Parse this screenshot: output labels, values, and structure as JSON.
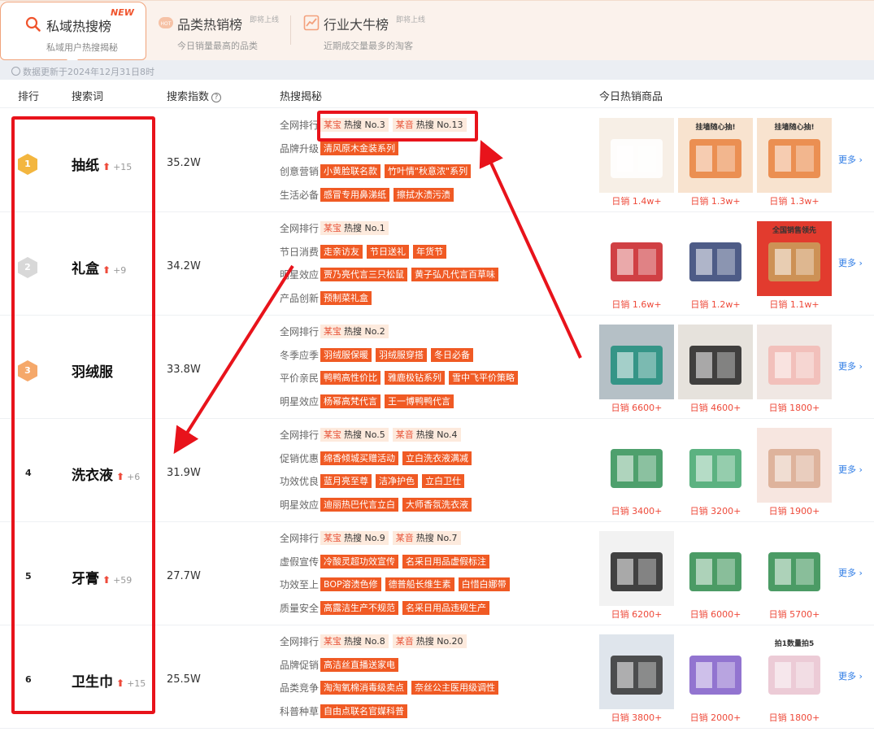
{
  "tabs": [
    {
      "title": "私域热搜榜",
      "subtitle": "私域用户热搜揭秘",
      "badge": "NEW"
    },
    {
      "title": "品类热销榜",
      "subtitle": "今日销量最高的品类",
      "badge": "即将上线"
    },
    {
      "title": "行业大牛榜",
      "subtitle": "近期成交量最多的淘客",
      "badge": "即将上线"
    }
  ],
  "notice": "数据更新于2024年12月31日8时",
  "columns": {
    "rank": "排行",
    "keyword": "搜索词",
    "index": "搜索指数",
    "insight": "热搜揭秘",
    "products": "今日热销商品",
    "help_icon": "?"
  },
  "more_label": "更多 ›",
  "colors": {
    "accent": "#f05a24",
    "link": "#2d7be5",
    "rise": "#ee4a3a",
    "annotation": "#e8131b"
  },
  "rows": [
    {
      "rank": "1",
      "keyword": "抽纸",
      "arrow": "⬆",
      "delta": "+15",
      "index": "35.2W",
      "sections": [
        {
          "label": "全网排行",
          "chips": [
            {
              "type": "rank",
              "platform": "某宝",
              "text": "热搜 No.3"
            },
            {
              "type": "rank",
              "platform": "某音",
              "text": "热搜 No.13"
            }
          ]
        },
        {
          "label": "品牌升级",
          "chips": [
            {
              "type": "orange",
              "text": "清风原木金装系列"
            }
          ]
        },
        {
          "label": "创意营销",
          "chips": [
            {
              "type": "orange",
              "text": "小黄脸联名款"
            },
            {
              "type": "orange",
              "text": "竹叶情\"秋意浓\"系列"
            }
          ]
        },
        {
          "label": "生活必备",
          "chips": [
            {
              "type": "orange",
              "text": "感冒专用鼻涕纸"
            },
            {
              "type": "orange",
              "text": "擦拭水渍污渍"
            }
          ]
        }
      ],
      "products": [
        {
          "sales": "日销 1.4w+"
        },
        {
          "sales": "日销 1.3w+",
          "caption": "挂墙随心抽!"
        },
        {
          "sales": "日销 1.3w+",
          "caption": "挂墙随心抽!"
        }
      ]
    },
    {
      "rank": "2",
      "keyword": "礼盒",
      "arrow": "⬆",
      "delta": "+9",
      "index": "34.2W",
      "sections": [
        {
          "label": "全网排行",
          "chips": [
            {
              "type": "rank",
              "platform": "某宝",
              "text": "热搜 No.1"
            }
          ]
        },
        {
          "label": "节日消费",
          "chips": [
            {
              "type": "orange",
              "text": "走亲访友"
            },
            {
              "type": "orange",
              "text": "节日送礼"
            },
            {
              "type": "orange",
              "text": "年货节"
            }
          ]
        },
        {
          "label": "明星效应",
          "chips": [
            {
              "type": "orange",
              "text": "贾乃亮代言三只松鼠"
            },
            {
              "type": "orange",
              "text": "黄子弘凡代言百草味"
            }
          ]
        },
        {
          "label": "产品创新",
          "chips": [
            {
              "type": "orange",
              "text": "预制菜礼盒"
            }
          ]
        }
      ],
      "products": [
        {
          "sales": "日销 1.6w+"
        },
        {
          "sales": "日销 1.2w+"
        },
        {
          "sales": "日销 1.1w+",
          "caption": "全国销售领先"
        }
      ]
    },
    {
      "rank": "3",
      "keyword": "羽绒服",
      "arrow": "",
      "delta": "",
      "index": "33.8W",
      "sections": [
        {
          "label": "全网排行",
          "chips": [
            {
              "type": "rank",
              "platform": "某宝",
              "text": "热搜 No.2"
            }
          ]
        },
        {
          "label": "冬季应季",
          "chips": [
            {
              "type": "orange",
              "text": "羽绒服保暖"
            },
            {
              "type": "orange",
              "text": "羽绒服穿搭"
            },
            {
              "type": "orange",
              "text": "冬日必备"
            }
          ]
        },
        {
          "label": "平价亲民",
          "chips": [
            {
              "type": "orange",
              "text": "鸭鸭高性价比"
            },
            {
              "type": "orange",
              "text": "雅鹿极钻系列"
            },
            {
              "type": "orange",
              "text": "雪中飞平价策略"
            }
          ]
        },
        {
          "label": "明星效应",
          "chips": [
            {
              "type": "orange",
              "text": "杨幂高梵代言"
            },
            {
              "type": "orange",
              "text": "王一博鸭鸭代言"
            }
          ]
        }
      ],
      "products": [
        {
          "sales": "日销 6600+"
        },
        {
          "sales": "日销 4600+"
        },
        {
          "sales": "日销 1800+"
        }
      ]
    },
    {
      "rank": "4",
      "keyword": "洗衣液",
      "arrow": "⬆",
      "delta": "+6",
      "index": "31.9W",
      "sections": [
        {
          "label": "全网排行",
          "chips": [
            {
              "type": "rank",
              "platform": "某宝",
              "text": "热搜 No.5"
            },
            {
              "type": "rank",
              "platform": "某音",
              "text": "热搜 No.4"
            }
          ]
        },
        {
          "label": "促销优惠",
          "chips": [
            {
              "type": "orange",
              "text": "绵香倾城买赠活动"
            },
            {
              "type": "orange",
              "text": "立白洗衣液满减"
            }
          ]
        },
        {
          "label": "功效优良",
          "chips": [
            {
              "type": "orange",
              "text": "蓝月亮至尊"
            },
            {
              "type": "orange",
              "text": "洁净护色"
            },
            {
              "type": "orange",
              "text": "立白卫仕"
            }
          ]
        },
        {
          "label": "明星效应",
          "chips": [
            {
              "type": "orange",
              "text": "迪丽热巴代言立白"
            },
            {
              "type": "orange",
              "text": "大师香氛洗衣液"
            }
          ]
        }
      ],
      "products": [
        {
          "sales": "日销 3400+"
        },
        {
          "sales": "日销 3200+"
        },
        {
          "sales": "日销 1900+"
        }
      ]
    },
    {
      "rank": "5",
      "keyword": "牙膏",
      "arrow": "⬆",
      "delta": "+59",
      "index": "27.7W",
      "sections": [
        {
          "label": "全网排行",
          "chips": [
            {
              "type": "rank",
              "platform": "某宝",
              "text": "热搜 No.9"
            },
            {
              "type": "rank",
              "platform": "某音",
              "text": "热搜 No.7"
            }
          ]
        },
        {
          "label": "虚假宣传",
          "chips": [
            {
              "type": "orange",
              "text": "冷酸灵超功效宣传"
            },
            {
              "type": "orange",
              "text": "名采日用品虚假标注"
            }
          ]
        },
        {
          "label": "功效至上",
          "chips": [
            {
              "type": "orange",
              "text": "BOP溶渍色修"
            },
            {
              "type": "orange",
              "text": "德普船长维生素"
            },
            {
              "type": "orange",
              "text": "白惜白娜带"
            }
          ]
        },
        {
          "label": "质量安全",
          "chips": [
            {
              "type": "orange",
              "text": "高露洁生产不规范"
            },
            {
              "type": "orange",
              "text": "名采日用品违规生产"
            }
          ]
        }
      ],
      "products": [
        {
          "sales": "日销 6200+"
        },
        {
          "sales": "日销 6000+"
        },
        {
          "sales": "日销 5700+"
        }
      ]
    },
    {
      "rank": "6",
      "keyword": "卫生巾",
      "arrow": "⬆",
      "delta": "+15",
      "index": "25.5W",
      "sections": [
        {
          "label": "全网排行",
          "chips": [
            {
              "type": "rank",
              "platform": "某宝",
              "text": "热搜 No.8"
            },
            {
              "type": "rank",
              "platform": "某音",
              "text": "热搜 No.20"
            }
          ]
        },
        {
          "label": "品牌促销",
          "chips": [
            {
              "type": "orange",
              "text": "高洁丝直播送家电"
            }
          ]
        },
        {
          "label": "品类竞争",
          "chips": [
            {
              "type": "orange",
              "text": "淘淘氧棉消毒级卖点"
            },
            {
              "type": "orange",
              "text": "奈丝公主医用级调性"
            }
          ]
        },
        {
          "label": "科普种草",
          "chips": [
            {
              "type": "orange",
              "text": "自由点联名官媒科普"
            }
          ]
        }
      ],
      "products": [
        {
          "sales": "日销 3800+"
        },
        {
          "sales": "日销 2000+"
        },
        {
          "sales": "日销 1800+",
          "caption": "拍1数量拍5"
        }
      ]
    }
  ]
}
